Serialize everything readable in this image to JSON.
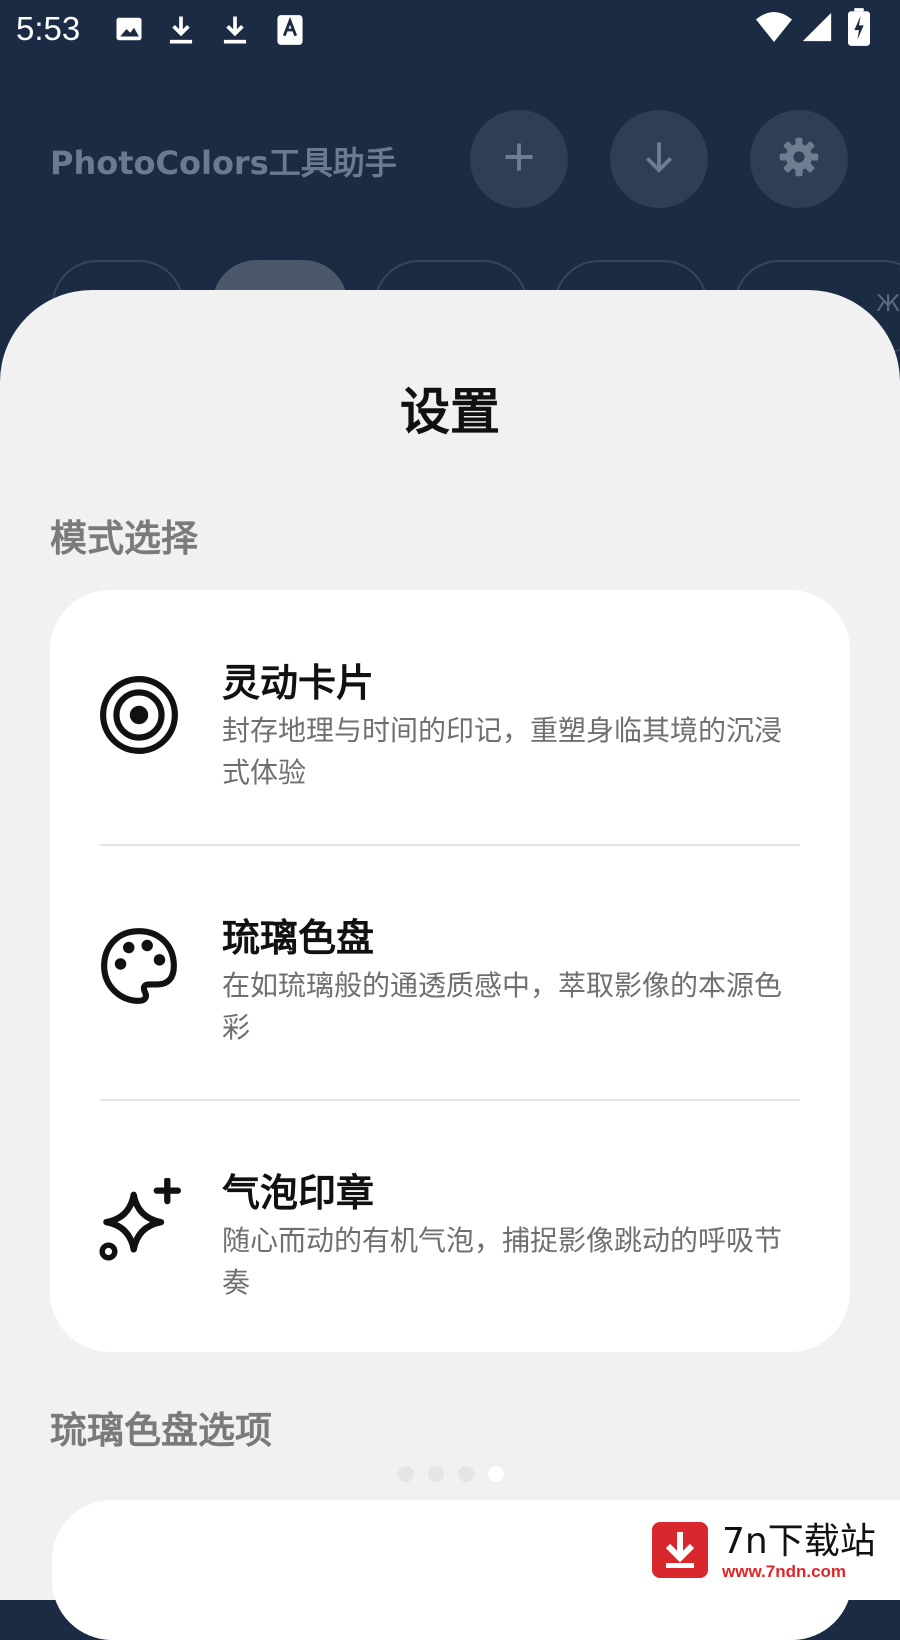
{
  "status_bar": {
    "time": "5:53",
    "left_icons": [
      "image-icon",
      "download-icon",
      "download-icon",
      "font-icon"
    ],
    "right_icons": [
      "wifi-icon",
      "signal-icon",
      "battery-charging-icon"
    ]
  },
  "app_bar": {
    "title": "PhotoColors工具助手",
    "buttons": [
      "add-icon",
      "download-icon",
      "gear-icon"
    ]
  },
  "chips": {
    "visible_label": "Ж"
  },
  "sheet": {
    "title": "设置",
    "mode_section_label": "模式选择",
    "modes": [
      {
        "icon": "target-icon",
        "title": "灵动卡片",
        "description": "封存地理与时间的印记，重塑身临其境的沉浸式体验"
      },
      {
        "icon": "palette-icon",
        "title": "琉璃色盘",
        "description": "在如琉璃般的通透质感中，萃取影像的本源色彩"
      },
      {
        "icon": "sparkles-icon",
        "title": "气泡印章",
        "description": "随心而动的有机气泡，捕捉影像跳动的呼吸节奏"
      }
    ],
    "options_section_label": "琉璃色盘选项"
  },
  "page_indicator": {
    "count": 4,
    "active_index": 3
  },
  "watermark": {
    "name": "7n下载站",
    "url": "www.7ndn.com"
  },
  "colors": {
    "background": "#1b2b44",
    "sheet": "#f1f1f1",
    "card": "#ffffff",
    "watermark_red": "#d9272e"
  }
}
